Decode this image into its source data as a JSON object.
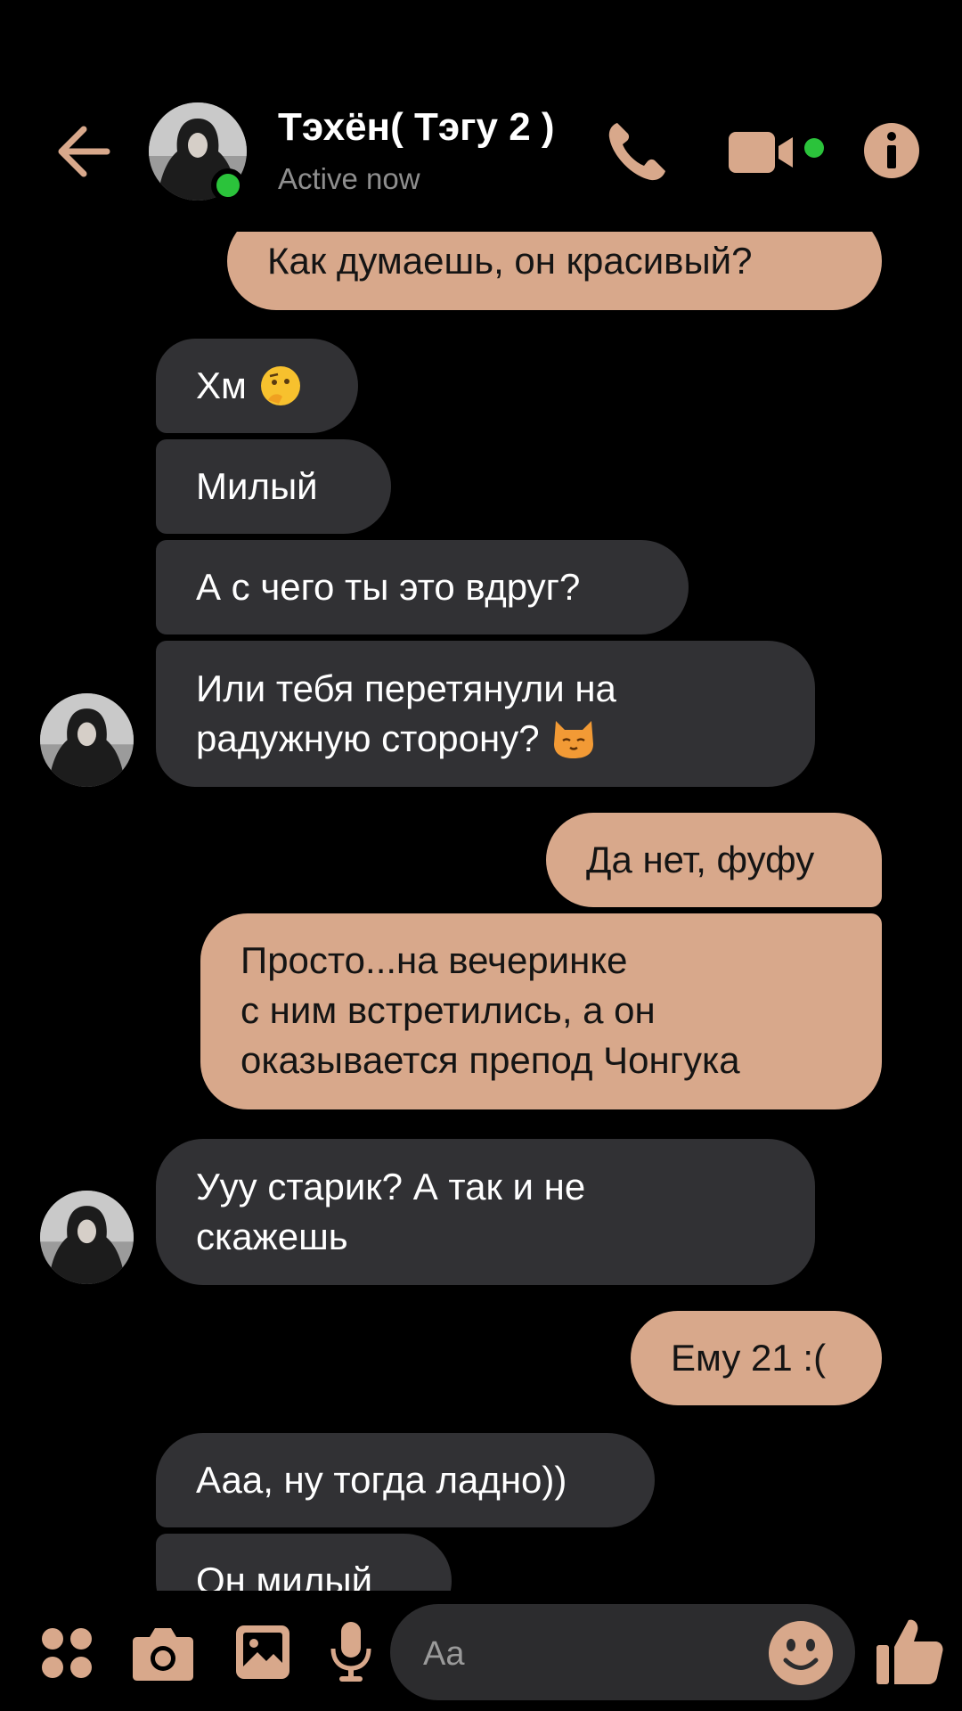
{
  "header": {
    "contact_name": "Тэхён( Тэгу 2 )",
    "status": "Active now"
  },
  "messages": [
    {
      "side": "out",
      "text": "Как думаешь, он красивый?"
    },
    {
      "side": "in",
      "text": "Хм"
    },
    {
      "side": "in",
      "text": "Милый"
    },
    {
      "side": "in",
      "text": "А с чего ты это вдруг?"
    },
    {
      "side": "in",
      "text_line1": "Или тебя перетянули на",
      "text_line2": "радужную сторону?"
    },
    {
      "side": "out",
      "text": "Да нет, фуфу"
    },
    {
      "side": "out",
      "text_line1": "Просто...на вечеринке",
      "text_line2": "с ним встретились, а он",
      "text_line3": "оказывается препод Чонгука"
    },
    {
      "side": "in",
      "text_line1": "Ууу старик? А так и не",
      "text_line2": "скажешь"
    },
    {
      "side": "out",
      "text": "Ему 21 :("
    },
    {
      "side": "in",
      "text": "Ааа, ну тогда ладно))"
    },
    {
      "side": "in",
      "text": "Он милый"
    }
  ],
  "composer": {
    "placeholder": "Aa"
  },
  "icons": [
    "back-arrow-icon",
    "phone-icon",
    "video-camera-icon",
    "info-icon",
    "apps-grid-icon",
    "camera-icon",
    "gallery-icon",
    "microphone-icon",
    "emoji-icon",
    "thumbs-up-icon",
    "thinking-face-icon",
    "cat-face-icon"
  ],
  "colors": {
    "accent": "#d8a88b",
    "incoming_bubble": "#313134",
    "presence": "#2bc33b",
    "background": "#000000"
  }
}
